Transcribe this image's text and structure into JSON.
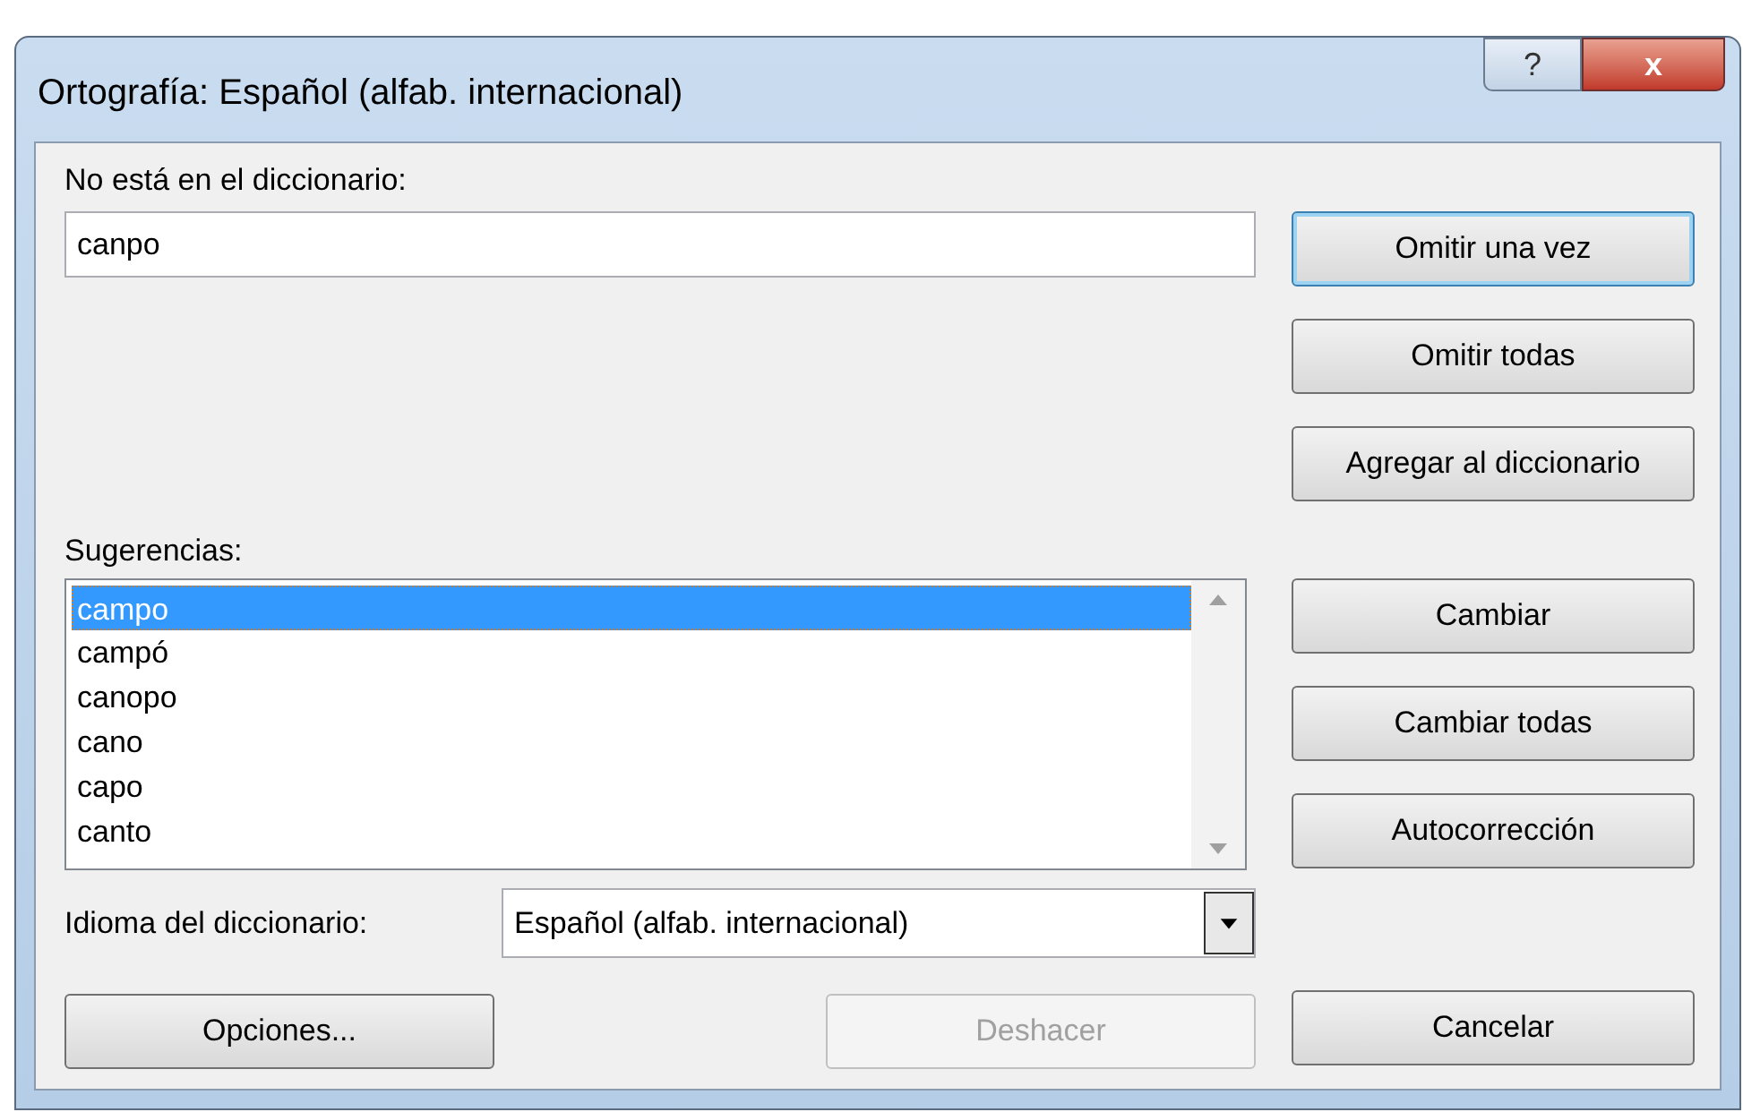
{
  "window": {
    "title": "Ortografía: Español (alfab. internacional)",
    "help": "?",
    "close": "x"
  },
  "not_in_dictionary": {
    "label": "No está en el diccionario:",
    "value": "canpo"
  },
  "suggestions": {
    "label": "Sugerencias:",
    "items": [
      {
        "text": "campo",
        "selected": true
      },
      {
        "text": "campó",
        "selected": false
      },
      {
        "text": "canopo",
        "selected": false
      },
      {
        "text": "cano",
        "selected": false
      },
      {
        "text": "capo",
        "selected": false
      },
      {
        "text": "canto",
        "selected": false
      }
    ]
  },
  "dictionary_language": {
    "label": "Idioma del diccionario:",
    "value": "Español (alfab. internacional)"
  },
  "side_buttons": [
    {
      "label": "Omitir una vez",
      "focused": true,
      "disabled": false
    },
    {
      "label": "Omitir todas",
      "focused": false,
      "disabled": false
    },
    {
      "label": "Agregar al diccionario",
      "focused": false,
      "disabled": false
    },
    {
      "label": "Cambiar",
      "focused": false,
      "disabled": false
    },
    {
      "label": "Cambiar todas",
      "focused": false,
      "disabled": false
    },
    {
      "label": "Autocorrección",
      "focused": false,
      "disabled": false
    }
  ],
  "bottom_buttons": [
    {
      "label": "Opciones...",
      "focused": false,
      "disabled": false
    },
    {
      "label": "Deshacer",
      "disabled": true
    },
    {
      "label": "Cancelar",
      "focused": false,
      "disabled": false
    }
  ]
}
